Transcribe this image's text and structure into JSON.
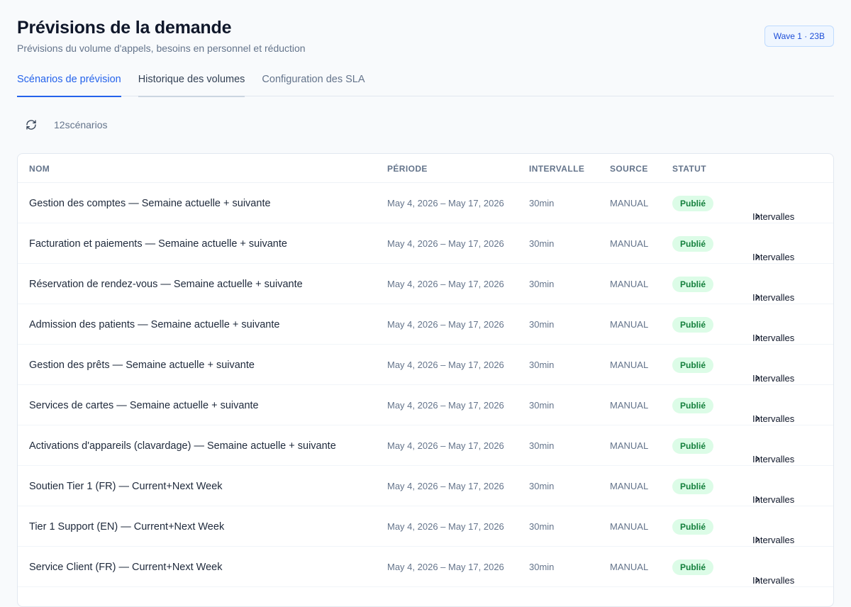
{
  "header": {
    "title": "Prévisions de la demande",
    "subtitle": "Prévisions du volume d'appels, besoins en personnel et réduction",
    "badge": "Wave 1 · 23B"
  },
  "tabs": [
    {
      "label": "Scénarios de prévision",
      "state": "active"
    },
    {
      "label": "Historique des volumes",
      "state": "hover"
    },
    {
      "label": "Configuration des SLA",
      "state": "default"
    }
  ],
  "toolbar": {
    "refresh_icon": "refresh-icon",
    "count_number": "12",
    "count_label": "scénarios"
  },
  "table": {
    "columns": [
      "NOM",
      "PÉRIODE",
      "INTERVALLE",
      "SOURCE",
      "STATUT"
    ],
    "rows": [
      {
        "name": "Gestion des comptes — Semaine actuelle + suivante",
        "period": "May 4, 2026 – May 17, 2026",
        "interval": "30min",
        "source": "MANUAL",
        "status": "Publié",
        "action": "Intervalles"
      },
      {
        "name": "Facturation et paiements — Semaine actuelle + suivante",
        "period": "May 4, 2026 – May 17, 2026",
        "interval": "30min",
        "source": "MANUAL",
        "status": "Publié",
        "action": "Intervalles"
      },
      {
        "name": "Réservation de rendez-vous — Semaine actuelle + suivante",
        "period": "May 4, 2026 – May 17, 2026",
        "interval": "30min",
        "source": "MANUAL",
        "status": "Publié",
        "action": "Intervalles"
      },
      {
        "name": "Admission des patients — Semaine actuelle + suivante",
        "period": "May 4, 2026 – May 17, 2026",
        "interval": "30min",
        "source": "MANUAL",
        "status": "Publié",
        "action": "Intervalles"
      },
      {
        "name": "Gestion des prêts — Semaine actuelle + suivante",
        "period": "May 4, 2026 – May 17, 2026",
        "interval": "30min",
        "source": "MANUAL",
        "status": "Publié",
        "action": "Intervalles"
      },
      {
        "name": "Services de cartes — Semaine actuelle + suivante",
        "period": "May 4, 2026 – May 17, 2026",
        "interval": "30min",
        "source": "MANUAL",
        "status": "Publié",
        "action": "Intervalles"
      },
      {
        "name": "Activations d'appareils (clavardage) — Semaine actuelle + suivante",
        "period": "May 4, 2026 – May 17, 2026",
        "interval": "30min",
        "source": "MANUAL",
        "status": "Publié",
        "action": "Intervalles"
      },
      {
        "name": "Soutien Tier 1 (FR) — Current+Next Week",
        "period": "May 4, 2026 – May 17, 2026",
        "interval": "30min",
        "source": "MANUAL",
        "status": "Publié",
        "action": "Intervalles"
      },
      {
        "name": "Tier 1 Support (EN) — Current+Next Week",
        "period": "May 4, 2026 – May 17, 2026",
        "interval": "30min",
        "source": "MANUAL",
        "status": "Publié",
        "action": "Intervalles"
      },
      {
        "name": "Service Client (FR) — Current+Next Week",
        "period": "May 4, 2026 – May 17, 2026",
        "interval": "30min",
        "source": "MANUAL",
        "status": "Publié",
        "action": "Intervalles"
      }
    ]
  },
  "colors": {
    "accent": "#2563eb",
    "status_bg": "#dcfce7",
    "status_text": "#15803d",
    "badge_bg": "#eff6ff",
    "badge_text": "#1d4ed8"
  }
}
